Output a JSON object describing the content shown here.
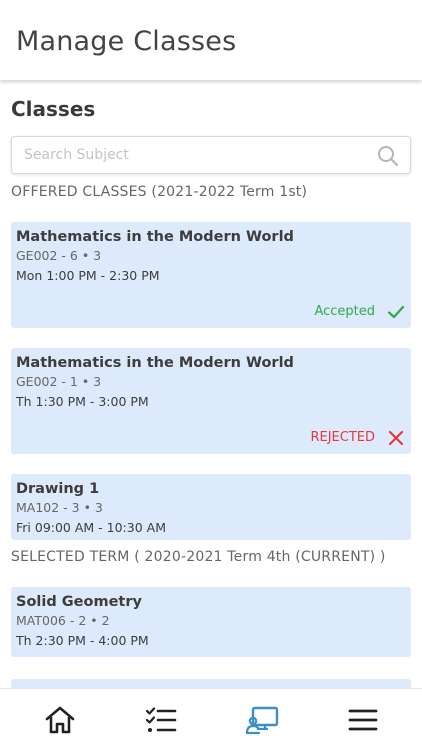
{
  "header": {
    "title": "Manage Classes"
  },
  "section": {
    "title": "Classes"
  },
  "search": {
    "placeholder": "Search Subject",
    "value": ""
  },
  "offered": {
    "label": "OFFERED CLASSES (2021-2022 Term 1st)",
    "cards": [
      {
        "name": "Mathematics in the Modern World",
        "code": "GE002 - 6 • 3",
        "time": "Mon 1:00 PM - 2:30 PM",
        "status": "Accepted",
        "status_color": "#2eaa4a",
        "status_icon": "check-icon"
      },
      {
        "name": "Mathematics in the Modern World",
        "code": "GE002 - 1 • 3",
        "time": "Th 1:30 PM - 3:00 PM",
        "status": "REJECTED",
        "status_color": "#e8383d",
        "status_icon": "x-icon"
      },
      {
        "name": "Drawing 1",
        "code": "MA102 - 3 • 3",
        "time": "Fri 09:00 AM - 10:30 AM"
      }
    ]
  },
  "selected": {
    "label": "SELECTED TERM ( 2020-2021 Term 4th (CURRENT) )",
    "cards": [
      {
        "name": "Solid Geometry",
        "code": "MAT006 - 2 • 2",
        "time": "Th 2:30 PM - 4:00 PM"
      }
    ]
  },
  "nav": {
    "items": [
      {
        "icon": "home-icon",
        "active": false
      },
      {
        "icon": "checklist-icon",
        "active": false
      },
      {
        "icon": "classroom-icon",
        "active": true
      },
      {
        "icon": "menu-icon",
        "active": false
      }
    ],
    "active_color": "#3a8fc9",
    "inactive_color": "#222222"
  }
}
